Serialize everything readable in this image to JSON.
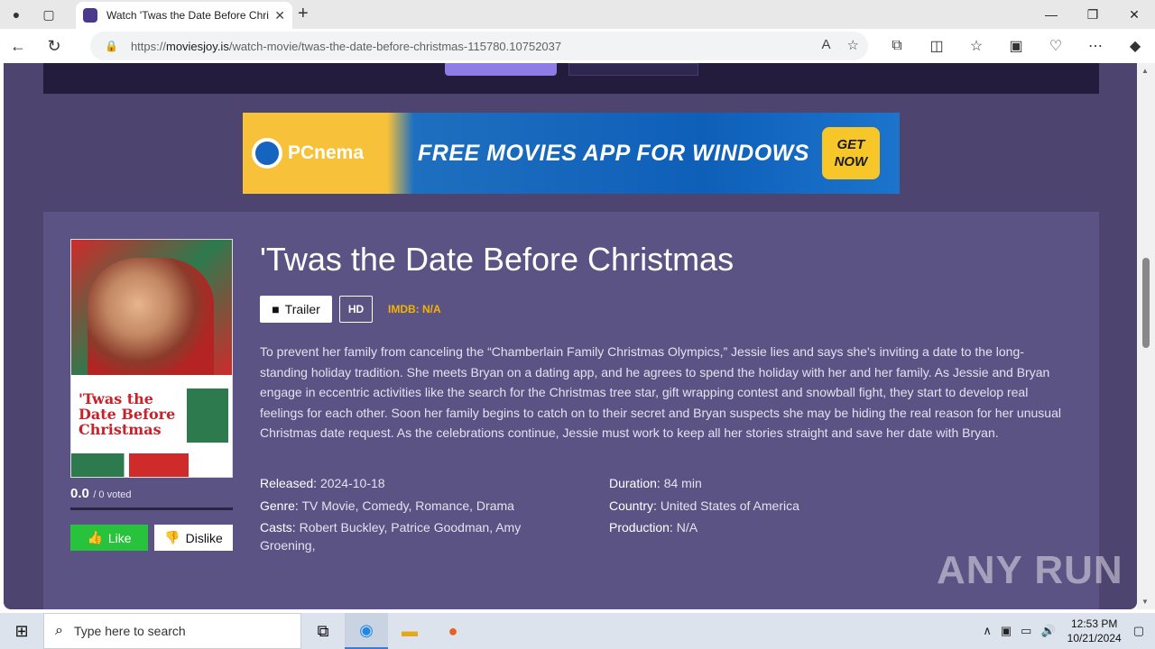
{
  "browser": {
    "tab_title": "Watch 'Twas the Date Before Christmas",
    "url_prefix": "https://",
    "url_domain": "moviesjoy.is",
    "url_path": "/watch-movie/twas-the-date-before-christmas-115780.10752037"
  },
  "banner": {
    "brand": "PCnema",
    "headline": "FREE MOVIES APP FOR WINDOWS",
    "cta": "GET NOW"
  },
  "movie": {
    "poster_title": "'Twas the Date Before Christmas",
    "title": "'Twas the Date Before Christmas",
    "trailer_label": "Trailer",
    "quality": "HD",
    "imdb": "IMDB: N/A",
    "description": "To prevent her family from canceling the “Chamberlain Family Christmas Olympics,” Jessie lies and says she's inviting a date to the long-standing holiday tradition. She meets Bryan on a dating app, and he agrees to spend the holiday with her and her family. As Jessie and Bryan engage in eccentric activities like the search for the Christmas tree star, gift wrapping contest and snowball fight, they start to develop real feelings for each other. Soon her family begins to catch on to their secret and Bryan suspects she may be hiding the real reason for her unusual Christmas date request. As the celebrations continue, Jessie must work to keep all her stories straight and save her date with Bryan.",
    "rating_score": "0.0",
    "rating_voted": "/ 0 voted",
    "like_label": "Like",
    "dislike_label": "Dislike",
    "released_label": "Released:",
    "released": "2024-10-18",
    "genre_label": "Genre:",
    "genre": "TV Movie, Comedy, Romance, Drama",
    "casts_label": "Casts:",
    "casts": "Robert Buckley, Patrice Goodman, Amy Groening,",
    "duration_label": "Duration:",
    "duration": "84 min",
    "country_label": "Country:",
    "country": "United States of America",
    "production_label": "Production:",
    "production": "N/A"
  },
  "watermark": "ANY RUN",
  "taskbar": {
    "search_placeholder": "Type here to search",
    "time": "12:53 PM",
    "date": "10/21/2024"
  }
}
